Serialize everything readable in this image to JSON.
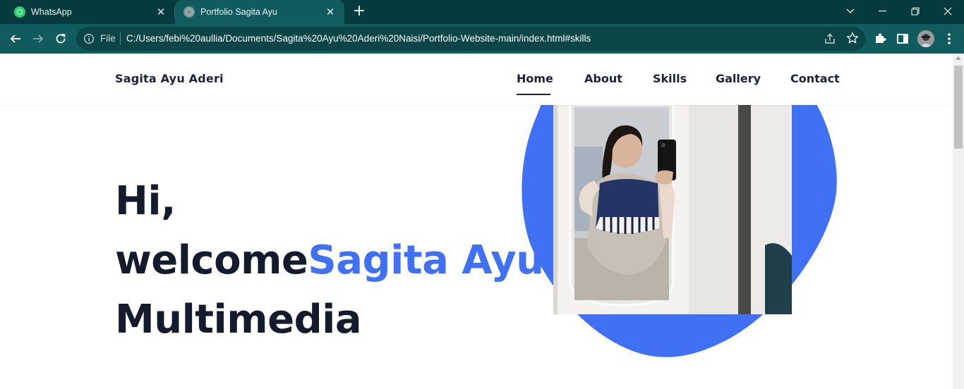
{
  "browser": {
    "tabs": [
      {
        "title": "WhatsApp",
        "icon": "whatsapp-icon",
        "active": false
      },
      {
        "title": "Portfolio Sagita Ayu",
        "icon": "globe-icon",
        "active": true
      }
    ],
    "address": {
      "scheme_label": "File",
      "url": "C:/Users/febi%20aullia/Documents/Sagita%20Ayu%20Aderi%20Naisi/Portfolio-Website-main/index.html#skills"
    },
    "colors": {
      "tabbar": "#053b3e",
      "toolbar": "#0f5b5e",
      "omnibox": "#0a4548"
    }
  },
  "site": {
    "logo": "Sagita Ayu Aderi",
    "nav": [
      {
        "label": "Home",
        "active": true
      },
      {
        "label": "About",
        "active": false
      },
      {
        "label": "Skills",
        "active": false
      },
      {
        "label": "Gallery",
        "active": false
      },
      {
        "label": "Contact",
        "active": false
      }
    ],
    "hero": {
      "line1": "Hi,",
      "line2_plain": "welcome",
      "line2_accent": "Sagita Ayu",
      "line3": "Multimedia"
    },
    "colors": {
      "accent": "#4070f4",
      "text": "#141b2d"
    }
  }
}
